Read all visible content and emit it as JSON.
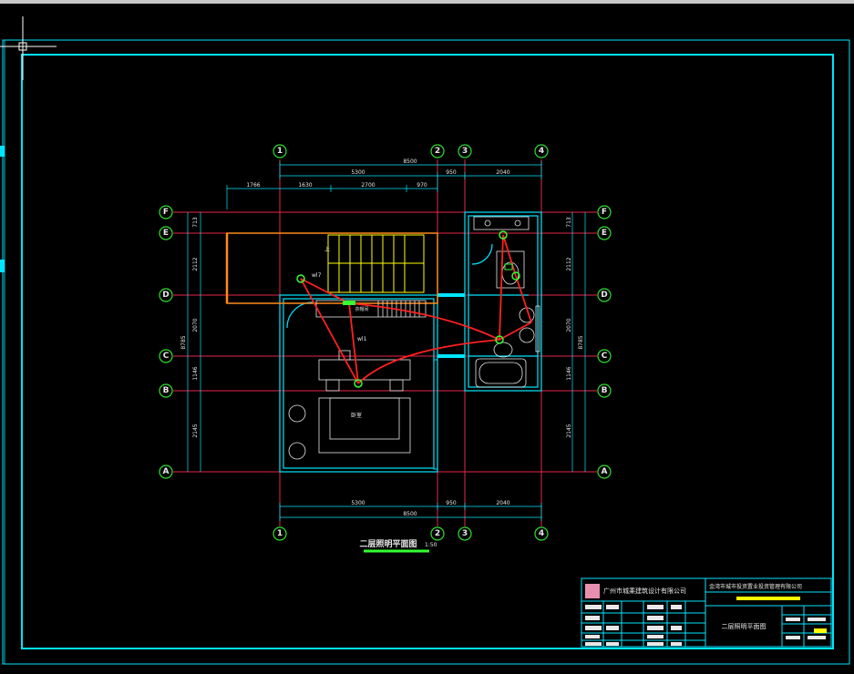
{
  "colors": {
    "frame": "#00e5ff",
    "axis": "#e8264a",
    "axis_bubble": "#2ee02e",
    "wall": "#00e5ff",
    "wiring": "#ff2020",
    "stair": "#ffff00",
    "orange": "#ff8a1a",
    "fixture": "#33ff33",
    "text": "#e8e8e8",
    "highlight": "#ffff00"
  },
  "axes": {
    "columns": [
      "1",
      "2",
      "3",
      "4"
    ],
    "rows": [
      "F",
      "E",
      "D",
      "C",
      "B",
      "A"
    ]
  },
  "dimensions": {
    "top_total": "8500",
    "top_segments": [
      "5300",
      "950",
      "2040"
    ],
    "top_detail": [
      "1766",
      "1630",
      "2700",
      "970"
    ],
    "bottom_total": "8500",
    "bottom_segments": [
      "5300",
      "950",
      "2040"
    ],
    "left_segments": [
      "713",
      "2112",
      "2070",
      "1146",
      "2145"
    ],
    "left_total": "8785",
    "right_segments": [
      "713",
      "2112",
      "2070",
      "1146",
      "2145"
    ],
    "right_total": "8785"
  },
  "labels": {
    "switch_1": "wl7",
    "switch_2": "wl1",
    "bed": "卧室",
    "closet": "衣帽间",
    "stair_up": "上"
  },
  "title": {
    "main": "二层照明平面图",
    "scale": "1:50"
  },
  "title_block": {
    "company": "广州市城乘建筑设计有限公司",
    "client": "金湾市城市投资置业投资管理有限公司",
    "drawing_name": "二层照明平面图"
  }
}
